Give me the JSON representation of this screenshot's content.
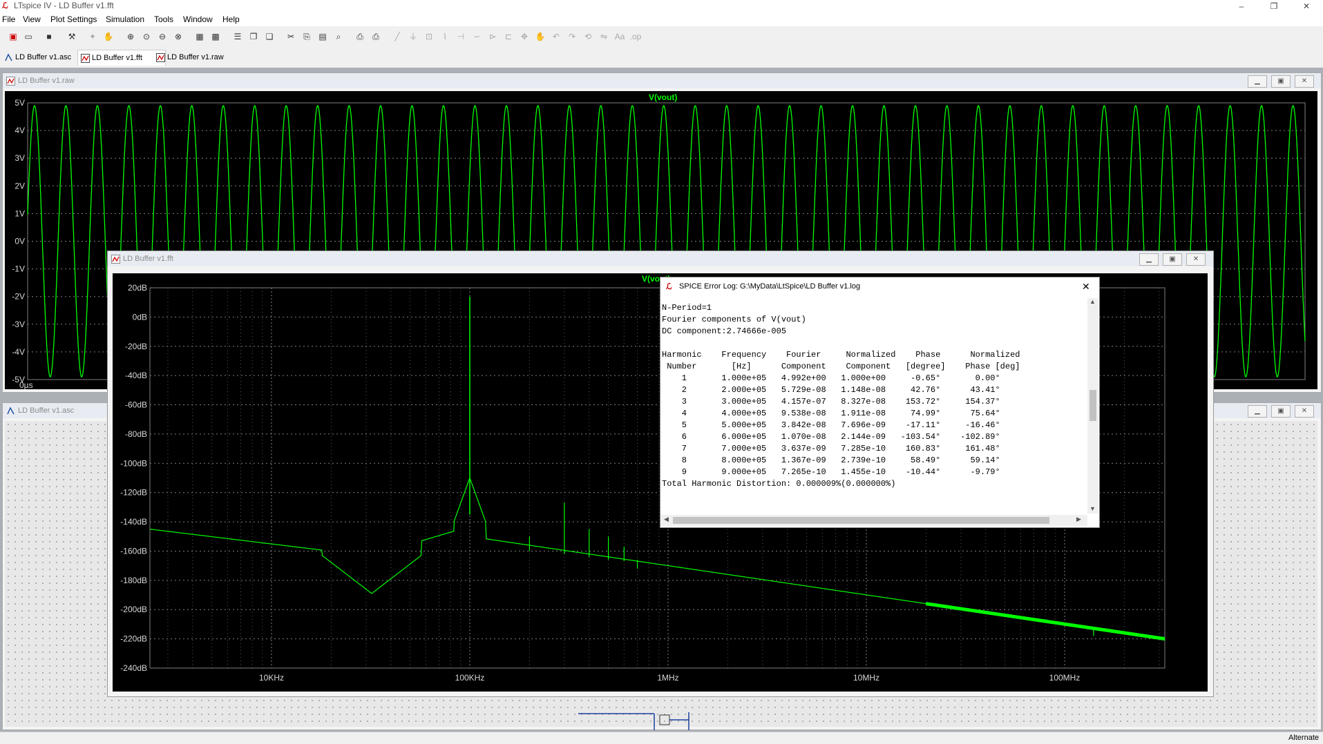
{
  "app": {
    "title": "LTspice IV - LD Buffer v1.fft",
    "window_controls": [
      "–",
      "❐",
      "✕"
    ]
  },
  "menu": [
    "File",
    "View",
    "Plot Settings",
    "Simulation",
    "Tools",
    "Window",
    "Help"
  ],
  "tabs": [
    {
      "label": "LD Buffer v1.asc",
      "active": false
    },
    {
      "label": "LD Buffer v1.fft",
      "active": true
    },
    {
      "label": "LD Buffer v1.raw",
      "active": false
    }
  ],
  "raw_window": {
    "title": "LD Buffer v1.raw",
    "trace": "V(vout)",
    "y_ticks": [
      "5V",
      "4V",
      "3V",
      "2V",
      "1V",
      "0V",
      "-1V",
      "-2V",
      "-3V",
      "-4V",
      "-5V"
    ],
    "x_first_tick": "0µs"
  },
  "asc_window": {
    "title": "LD Buffer v1.asc"
  },
  "fft_window": {
    "title": "LD Buffer v1.fft",
    "trace": "V(vout)",
    "y_ticks": [
      "20dB",
      "0dB",
      "-20dB",
      "-40dB",
      "-60dB",
      "-80dB",
      "-100dB",
      "-120dB",
      "-140dB",
      "-160dB",
      "-180dB",
      "-200dB",
      "-220dB",
      "-240dB"
    ],
    "x_ticks": [
      "10KHz",
      "100KHz",
      "1MHz",
      "10MHz",
      "100MHz"
    ]
  },
  "error_log": {
    "title": "SPICE Error Log: G:\\MyData\\LtSpice\\LD Buffer v1.log",
    "lines": [
      "N-Period=1",
      "Fourier components of V(vout)",
      "DC component:2.74666e-005",
      "",
      "Harmonic    Frequency    Fourier     Normalized    Phase      Normalized",
      " Number       [Hz]      Component    Component   [degree]    Phase [deg]",
      "    1       1.000e+05   4.992e+00   1.000e+00     -0.65°       0.00°",
      "    2       2.000e+05   5.729e-08   1.148e-08     42.76°      43.41°",
      "    3       3.000e+05   4.157e-07   8.327e-08    153.72°     154.37°",
      "    4       4.000e+05   9.538e-08   1.911e-08     74.99°      75.64°",
      "    5       5.000e+05   3.842e-08   7.696e-09    -17.11°     -16.46°",
      "    6       6.000e+05   1.070e-08   2.144e-09   -103.54°    -102.89°",
      "    7       7.000e+05   3.637e-09   7.285e-10    160.83°     161.48°",
      "    8       8.000e+05   1.367e-09   2.739e-10     58.49°      59.14°",
      "    9       9.000e+05   7.265e-10   1.455e-10    -10.44°      -9.79°",
      "Total Harmonic Distortion: 0.000009%(0.000000%)"
    ]
  },
  "status": {
    "right": "Alternate"
  },
  "colors": {
    "trace": "#00ff00",
    "plot_bg": "#000000",
    "grid": "#808080"
  }
}
